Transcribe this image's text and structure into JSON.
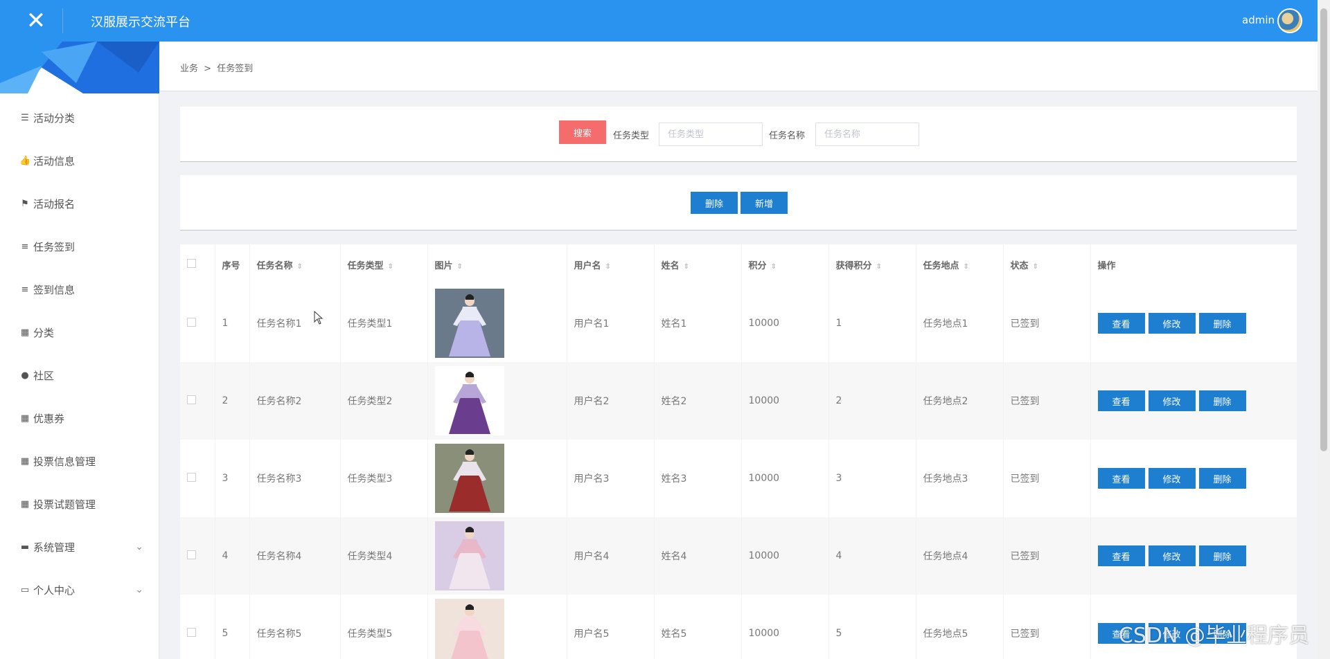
{
  "app": {
    "title": "汉服展示交流平台",
    "user": "admin"
  },
  "breadcrumb": {
    "parent": "业务",
    "sep": ">",
    "current": "任务签到"
  },
  "sidebar": {
    "items": [
      {
        "label": "活动分类",
        "icon": "sliders-icon"
      },
      {
        "label": "活动信息",
        "icon": "thumbs-up-icon"
      },
      {
        "label": "活动报名",
        "icon": "flag-icon"
      },
      {
        "label": "任务签到",
        "icon": "list-icon"
      },
      {
        "label": "签到信息",
        "icon": "list-icon"
      },
      {
        "label": "分类",
        "icon": "grid-icon"
      },
      {
        "label": "社区",
        "icon": "map-pin-icon"
      },
      {
        "label": "优惠券",
        "icon": "grid-icon"
      },
      {
        "label": "投票信息管理",
        "icon": "grid-icon"
      },
      {
        "label": "投票试题管理",
        "icon": "grid-icon"
      },
      {
        "label": "系统管理",
        "icon": "gamepad-icon",
        "expandable": true
      },
      {
        "label": "个人中心",
        "icon": "calendar-icon",
        "expandable": true
      }
    ]
  },
  "search": {
    "button": "搜索",
    "type_label": "任务类型",
    "type_placeholder": "任务类型",
    "name_label": "任务名称",
    "name_placeholder": "任务名称"
  },
  "actions": {
    "delete": "删除",
    "add": "新增"
  },
  "table": {
    "headers": [
      "序号",
      "任务名称",
      "任务类型",
      "图片",
      "用户名",
      "姓名",
      "积分",
      "获得积分",
      "任务地点",
      "状态",
      "操作"
    ],
    "op_labels": {
      "view": "查看",
      "edit": "修改",
      "delete": "删除"
    },
    "rows": [
      {
        "no": "1",
        "name": "任务名称1",
        "type": "任务类型1",
        "user": "用户名1",
        "realname": "姓名1",
        "points": "10000",
        "earned": "1",
        "place": "任务地点1",
        "status": "已签到"
      },
      {
        "no": "2",
        "name": "任务名称2",
        "type": "任务类型2",
        "user": "用户名2",
        "realname": "姓名2",
        "points": "10000",
        "earned": "2",
        "place": "任务地点2",
        "status": "已签到"
      },
      {
        "no": "3",
        "name": "任务名称3",
        "type": "任务类型3",
        "user": "用户名3",
        "realname": "姓名3",
        "points": "10000",
        "earned": "3",
        "place": "任务地点3",
        "status": "已签到"
      },
      {
        "no": "4",
        "name": "任务名称4",
        "type": "任务类型4",
        "user": "用户名4",
        "realname": "姓名4",
        "points": "10000",
        "earned": "4",
        "place": "任务地点4",
        "status": "已签到"
      },
      {
        "no": "5",
        "name": "任务名称5",
        "type": "任务类型5",
        "user": "用户名5",
        "realname": "姓名5",
        "points": "10000",
        "earned": "5",
        "place": "任务地点5",
        "status": "已签到"
      }
    ]
  },
  "watermark": "CSDN @毕业程序员",
  "colors": {
    "topbar": "#2a92ef",
    "search_button": "#f56c6c",
    "action_button": "#1e7fd0"
  }
}
